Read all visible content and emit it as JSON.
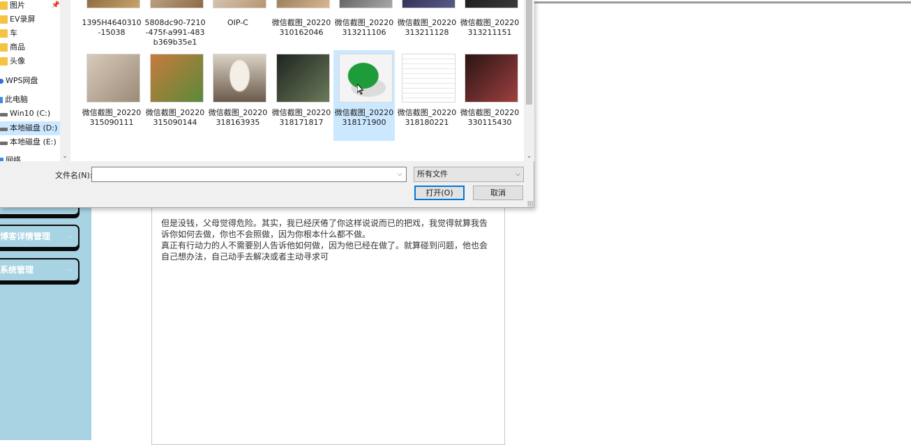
{
  "app": {
    "menu": [
      {
        "label": "",
        "chevron": ""
      },
      {
        "label": "博客详情管理",
        "chevron": "⌵"
      },
      {
        "label": "系统管理",
        "chevron": "⌵"
      }
    ],
    "article": {
      "paragraphs": [
        "但是没钱，父母觉得危险。其实，我已经厌倦了你这样说说而已的把戏，我觉得就算我告诉你如何去做，你也不会照做，因为你根本什么都不做。",
        "真正有行动力的人不需要别人告诉他如何做，因为他已经在做了。就算碰到问题，他也会自己想办法，自己动手去解决或者主动寻求可"
      ]
    }
  },
  "dialog": {
    "nav": [
      {
        "label": "图片",
        "icon": "folder-icon",
        "pinned": true
      },
      {
        "label": "EV录屏",
        "icon": "folder-icon"
      },
      {
        "label": "车",
        "icon": "folder-icon"
      },
      {
        "label": "商品",
        "icon": "folder-icon"
      },
      {
        "label": "头像",
        "icon": "folder-icon"
      },
      {
        "label": "WPS网盘",
        "icon": "cloud-icon"
      },
      {
        "label": "此电脑",
        "icon": "computer-icon"
      },
      {
        "label": "Win10 (C:)",
        "icon": "drive-icon"
      },
      {
        "label": "本地磁盘 (D:)",
        "icon": "drive-icon",
        "selected": true
      },
      {
        "label": "本地磁盘 (E:)",
        "icon": "drive-icon"
      },
      {
        "label": "网络",
        "icon": "network-icon"
      }
    ],
    "pin_glyph": "📌",
    "files_row1": [
      {
        "name": "1395H4640310-15038",
        "thumb": [
          "#6b4a2a",
          "#c9a46a"
        ]
      },
      {
        "name": "5808dc90-7210-475f-a991-483b369b35e1",
        "thumb": [
          "#d9c3a5",
          "#8c6a46"
        ]
      },
      {
        "name": "OIP-C",
        "thumb": [
          "#e8e2d8",
          "#b69570"
        ]
      },
      {
        "name": "微信截图_20220310162046",
        "thumb": [
          "#7a5c3c",
          "#d7b891"
        ]
      },
      {
        "name": "微信截图_20220313211106",
        "thumb": [
          "#3a3a3a",
          "#a9a9a9"
        ]
      },
      {
        "name": "微信截图_20220313211128",
        "thumb": [
          "#1c1c3a",
          "#5a5a8a"
        ]
      },
      {
        "name": "微信截图_20220313211151",
        "thumb": [
          "#0e0e0e",
          "#3a3a3a"
        ]
      }
    ],
    "files_row2": [
      {
        "name": "微信截图_20220315090111",
        "thumb": [
          "#d8cbbb",
          "#9c8a78"
        ],
        "kind": "book-photo"
      },
      {
        "name": "微信截图_20220315090144",
        "thumb": [
          "#c77b3c",
          "#5a8a3a"
        ],
        "kind": "books-apple"
      },
      {
        "name": "微信截图_20220318163935",
        "thumb": [
          "#d9d2c5",
          "#6b5a4a"
        ],
        "kind": "painting"
      },
      {
        "name": "微信截图_20220318171817",
        "thumb": [
          "#1e2420",
          "#6b7a5a"
        ],
        "kind": "bronze-ox"
      },
      {
        "name": "微信截图_20220318171900",
        "thumb": [
          "#f4f4f4",
          "#1f9c3a"
        ],
        "kind": "jade",
        "selected": true
      },
      {
        "name": "微信截图_20220318180221",
        "thumb": [
          "#fafafa",
          "#d0d0d0"
        ],
        "kind": "document"
      },
      {
        "name": "微信截图_20220330115430",
        "thumb": [
          "#2a1414",
          "#a04040"
        ],
        "kind": "movie-poster"
      }
    ],
    "filename_label": "文件名(N):",
    "filename_value": "",
    "filetype": "所有文件",
    "open_label": "打开(O)",
    "cancel_label": "取消",
    "dropdown_glyph": "⌵",
    "scroll_down_glyph": "⌄"
  }
}
